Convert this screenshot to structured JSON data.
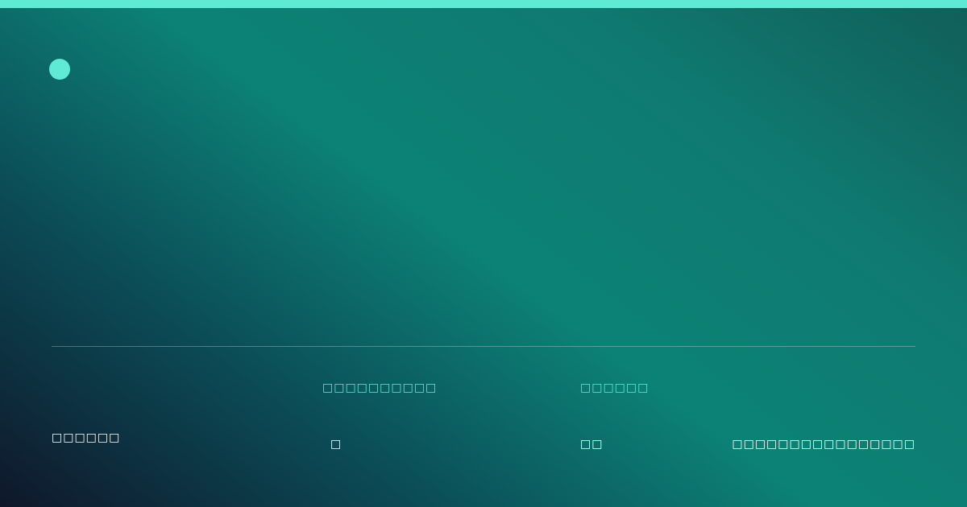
{
  "colors": {
    "accent": "#5eead4",
    "text": "#ffffff",
    "background_start": "#0f172a",
    "background_mid": "#0c8276",
    "background_end": "#115e59"
  },
  "brand": {
    "icon": "brand-dot-icon"
  },
  "footer": {
    "left_text": "□□□□□□",
    "stats": [
      {
        "label": "□□□□□□□□□□",
        "value": "□"
      },
      {
        "label": "□□□□□□",
        "value": "□□"
      }
    ],
    "right_text": "□□□□□□□□□□□□□□□□"
  }
}
